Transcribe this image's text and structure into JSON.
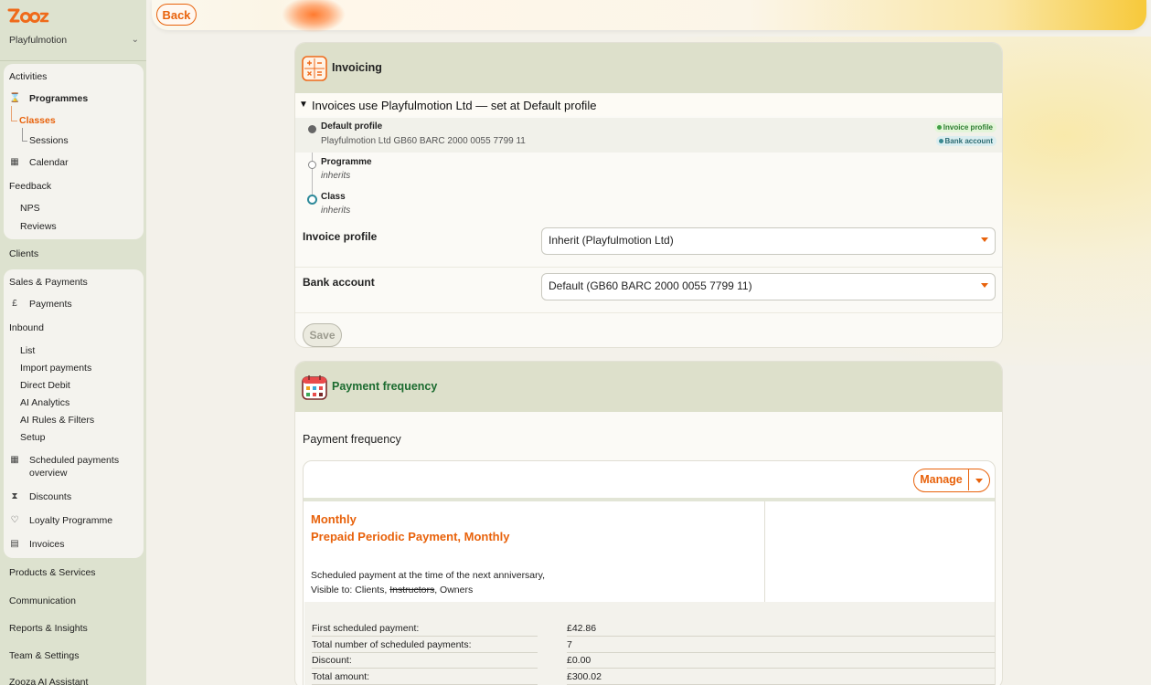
{
  "brand": {
    "logo_text": "Zooza",
    "accent": "#e8620b",
    "green": "#1b6b2f"
  },
  "sidebar": {
    "org_name": "Playfulmotion",
    "activities": "Activities",
    "programmes": "Programmes",
    "classes": "Classes",
    "sessions": "Sessions",
    "calendar": "Calendar",
    "feedback": "Feedback",
    "nps": "NPS",
    "reviews": "Reviews",
    "clients": "Clients",
    "sales_payments": "Sales & Payments",
    "payments": "Payments",
    "inbound": "Inbound",
    "inbound_items": [
      "List",
      "Import payments",
      "Direct Debit",
      "AI Analytics",
      "AI Rules & Filters",
      "Setup"
    ],
    "scheduled_1": "Scheduled payments",
    "scheduled_2": "overview",
    "discounts": "Discounts",
    "loyalty": "Loyalty Programme",
    "invoices": "Invoices",
    "products": "Products & Services",
    "communication": "Communication",
    "reports": "Reports & Insights",
    "team": "Team & Settings",
    "assistant": "Zooza AI Assistant"
  },
  "topbar": {
    "back_label": "Back"
  },
  "invoicing": {
    "title": "Invoicing",
    "summary": "Invoices use Playfulmotion Ltd — set at Default profile",
    "timeline": [
      {
        "title": "Default profile",
        "sub": "Playfulmotion Ltd GB60 BARC 2000 0055 7799 11"
      },
      {
        "title": "Programme",
        "sub": "inherits"
      },
      {
        "title": "Class",
        "sub": "inherits"
      }
    ],
    "badges": [
      "Invoice profile",
      "Bank account"
    ],
    "invoice_profile_label": "Invoice profile",
    "invoice_profile_value": "Inherit (Playfulmotion Ltd)",
    "bank_account_label": "Bank account",
    "bank_account_value": "Default (GB60 BARC 2000 0055 7799 11)",
    "save_label": "Save"
  },
  "payment_frequency": {
    "title": "Payment frequency",
    "section_label": "Payment frequency",
    "manage_label": "Manage",
    "plan_name": "Monthly",
    "plan_type": "Prepaid Periodic Payment, Monthly",
    "description": "Scheduled payment at the time of the next anniversary,",
    "visible_prefix": "Visible to: Clients, ",
    "visible_struck": "Instructors",
    "visible_suffix": ", Owners",
    "details": [
      {
        "key": "First scheduled payment:",
        "value": "£42.86"
      },
      {
        "key": "Total number of scheduled payments:",
        "value": "7"
      },
      {
        "key": "Discount:",
        "value": "£0.00"
      },
      {
        "key": "Total amount:",
        "value": "£300.02"
      }
    ]
  }
}
